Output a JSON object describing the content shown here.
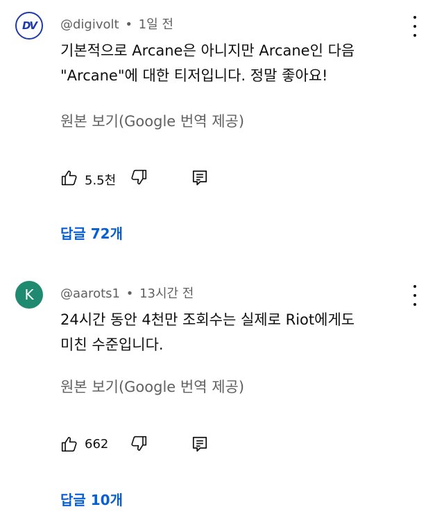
{
  "comments": [
    {
      "avatar_text": "DV",
      "author": "@digivolt",
      "time": "1일 전",
      "text_lines": [
        "기본적으로 Arcane은 아니지만 Arcane인 다음",
        "\"Arcane\"에 대한 티저입니다. 정말 좋아요!"
      ],
      "translate_label": "원본 보기(Google 번역 제공)",
      "likes": "5.5천",
      "replies_label": "답글 72개"
    },
    {
      "avatar_text": "K",
      "author": "@aarots1",
      "time": "13시간 전",
      "text_lines": [
        "24시간 동안 4천만 조회수는 실제로 Riot에게도",
        "미친 수준입니다."
      ],
      "translate_label": "원본 보기(Google 번역 제공)",
      "likes": "662",
      "replies_label": "답글 10개"
    }
  ],
  "separator": "•",
  "colors": {
    "link_blue": "#065fd4",
    "secondary_text": "#606060",
    "avatar_k_bg": "#1f8a70",
    "avatar_dv_border": "#1e3aa8"
  }
}
